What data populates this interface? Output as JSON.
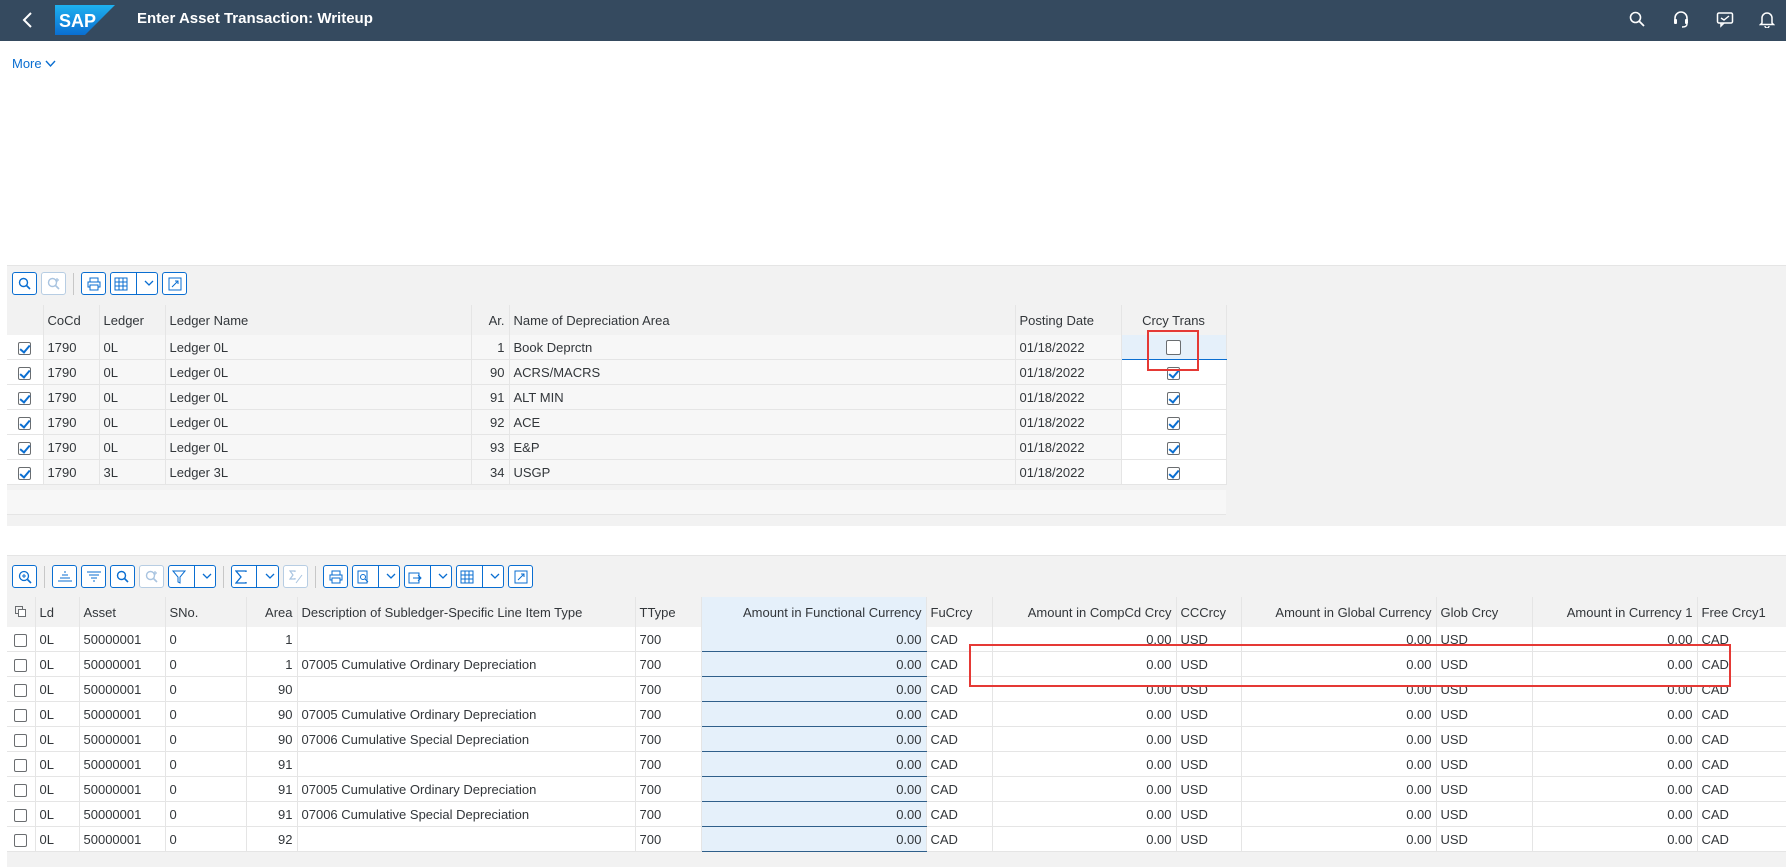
{
  "shell": {
    "title": "Enter Asset Transaction: Writeup",
    "icons": [
      "back-icon",
      "sap-logo",
      "search-icon",
      "headset-icon",
      "feedback-icon",
      "bell-icon"
    ]
  },
  "more_label": "More",
  "table1": {
    "headers": [
      "CoCd",
      "Ledger",
      "Ledger Name",
      "Ar.",
      "Name of Depreciation Area",
      "Posting Date",
      "Crcy Trans"
    ],
    "rows": [
      {
        "sel": true,
        "cocd": "1790",
        "ledger": "0L",
        "ledger_name": "Ledger 0L",
        "ar": "1",
        "area_name": "Book Deprctn",
        "date": "01/18/2022",
        "crcy": false
      },
      {
        "sel": true,
        "cocd": "1790",
        "ledger": "0L",
        "ledger_name": "Ledger 0L",
        "ar": "90",
        "area_name": "ACRS/MACRS",
        "date": "01/18/2022",
        "crcy": true
      },
      {
        "sel": true,
        "cocd": "1790",
        "ledger": "0L",
        "ledger_name": "Ledger 0L",
        "ar": "91",
        "area_name": "ALT MIN",
        "date": "01/18/2022",
        "crcy": true
      },
      {
        "sel": true,
        "cocd": "1790",
        "ledger": "0L",
        "ledger_name": "Ledger 0L",
        "ar": "92",
        "area_name": "ACE",
        "date": "01/18/2022",
        "crcy": true
      },
      {
        "sel": true,
        "cocd": "1790",
        "ledger": "0L",
        "ledger_name": "Ledger 0L",
        "ar": "93",
        "area_name": "E&P",
        "date": "01/18/2022",
        "crcy": true
      },
      {
        "sel": true,
        "cocd": "1790",
        "ledger": "3L",
        "ledger_name": "Ledger 3L",
        "ar": "34",
        "area_name": "USGP",
        "date": "01/18/2022",
        "crcy": true
      }
    ]
  },
  "table2": {
    "headers": [
      "Ld",
      "Asset",
      "SNo.",
      "Area",
      "Description of Subledger-Specific Line Item Type",
      "TType",
      "Amount in Functional Currency",
      "FuCrcy",
      "Amount in CompCd Crcy",
      "CCCrcy",
      "Amount in Global Currency",
      "Glob Crcy",
      "Amount in Currency 1",
      "Free Crcy1"
    ],
    "rows": [
      {
        "ld": "0L",
        "asset": "50000001",
        "sno": "0",
        "area": "1",
        "desc": "",
        "ttype": "700",
        "amt_fc": "0.00",
        "fucrcy": "CAD",
        "amt_cc": "0.00",
        "cccrcy": "USD",
        "amt_gc": "0.00",
        "globcrcy": "USD",
        "amt_c1": "0.00",
        "freecrcy": "CAD"
      },
      {
        "ld": "0L",
        "asset": "50000001",
        "sno": "0",
        "area": "1",
        "desc": "07005 Cumulative Ordinary Depreciation",
        "ttype": "700",
        "amt_fc": "0.00",
        "fucrcy": "CAD",
        "amt_cc": "0.00",
        "cccrcy": "USD",
        "amt_gc": "0.00",
        "globcrcy": "USD",
        "amt_c1": "0.00",
        "freecrcy": "CAD"
      },
      {
        "ld": "0L",
        "asset": "50000001",
        "sno": "0",
        "area": "90",
        "desc": "",
        "ttype": "700",
        "amt_fc": "0.00",
        "fucrcy": "CAD",
        "amt_cc": "0.00",
        "cccrcy": "USD",
        "amt_gc": "0.00",
        "globcrcy": "USD",
        "amt_c1": "0.00",
        "freecrcy": "CAD"
      },
      {
        "ld": "0L",
        "asset": "50000001",
        "sno": "0",
        "area": "90",
        "desc": "07005 Cumulative Ordinary Depreciation",
        "ttype": "700",
        "amt_fc": "0.00",
        "fucrcy": "CAD",
        "amt_cc": "0.00",
        "cccrcy": "USD",
        "amt_gc": "0.00",
        "globcrcy": "USD",
        "amt_c1": "0.00",
        "freecrcy": "CAD"
      },
      {
        "ld": "0L",
        "asset": "50000001",
        "sno": "0",
        "area": "90",
        "desc": "07006 Cumulative Special Depreciation",
        "ttype": "700",
        "amt_fc": "0.00",
        "fucrcy": "CAD",
        "amt_cc": "0.00",
        "cccrcy": "USD",
        "amt_gc": "0.00",
        "globcrcy": "USD",
        "amt_c1": "0.00",
        "freecrcy": "CAD"
      },
      {
        "ld": "0L",
        "asset": "50000001",
        "sno": "0",
        "area": "91",
        "desc": "",
        "ttype": "700",
        "amt_fc": "0.00",
        "fucrcy": "CAD",
        "amt_cc": "0.00",
        "cccrcy": "USD",
        "amt_gc": "0.00",
        "globcrcy": "USD",
        "amt_c1": "0.00",
        "freecrcy": "CAD"
      },
      {
        "ld": "0L",
        "asset": "50000001",
        "sno": "0",
        "area": "91",
        "desc": "07005 Cumulative Ordinary Depreciation",
        "ttype": "700",
        "amt_fc": "0.00",
        "fucrcy": "CAD",
        "amt_cc": "0.00",
        "cccrcy": "USD",
        "amt_gc": "0.00",
        "globcrcy": "USD",
        "amt_c1": "0.00",
        "freecrcy": "CAD"
      },
      {
        "ld": "0L",
        "asset": "50000001",
        "sno": "0",
        "area": "91",
        "desc": "07006 Cumulative Special Depreciation",
        "ttype": "700",
        "amt_fc": "0.00",
        "fucrcy": "CAD",
        "amt_cc": "0.00",
        "cccrcy": "USD",
        "amt_gc": "0.00",
        "globcrcy": "USD",
        "amt_c1": "0.00",
        "freecrcy": "CAD"
      },
      {
        "ld": "0L",
        "asset": "50000001",
        "sno": "0",
        "area": "92",
        "desc": "",
        "ttype": "700",
        "amt_fc": "0.00",
        "fucrcy": "CAD",
        "amt_cc": "0.00",
        "cccrcy": "USD",
        "amt_gc": "0.00",
        "globcrcy": "USD",
        "amt_c1": "0.00",
        "freecrcy": "CAD"
      }
    ]
  },
  "colors": {
    "shell": "#354a5f",
    "accent": "#0a6ed1",
    "highlight": "#e53935",
    "functional_col": "#e5f0fa"
  }
}
